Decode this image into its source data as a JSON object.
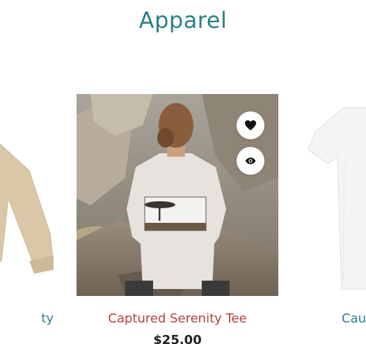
{
  "section": {
    "title": "Apparel"
  },
  "products": [
    {
      "name": "ty",
      "price": ""
    },
    {
      "name": "Captured Serenity Tee",
      "price": "$25.00"
    },
    {
      "name": "Cau",
      "price": ""
    }
  ],
  "icons": {
    "wishlist": "heart-icon",
    "quickview": "eye-icon"
  },
  "colors": {
    "title": "#2a7f89",
    "active_name": "#b5403e",
    "side_name": "#2a7f89"
  }
}
